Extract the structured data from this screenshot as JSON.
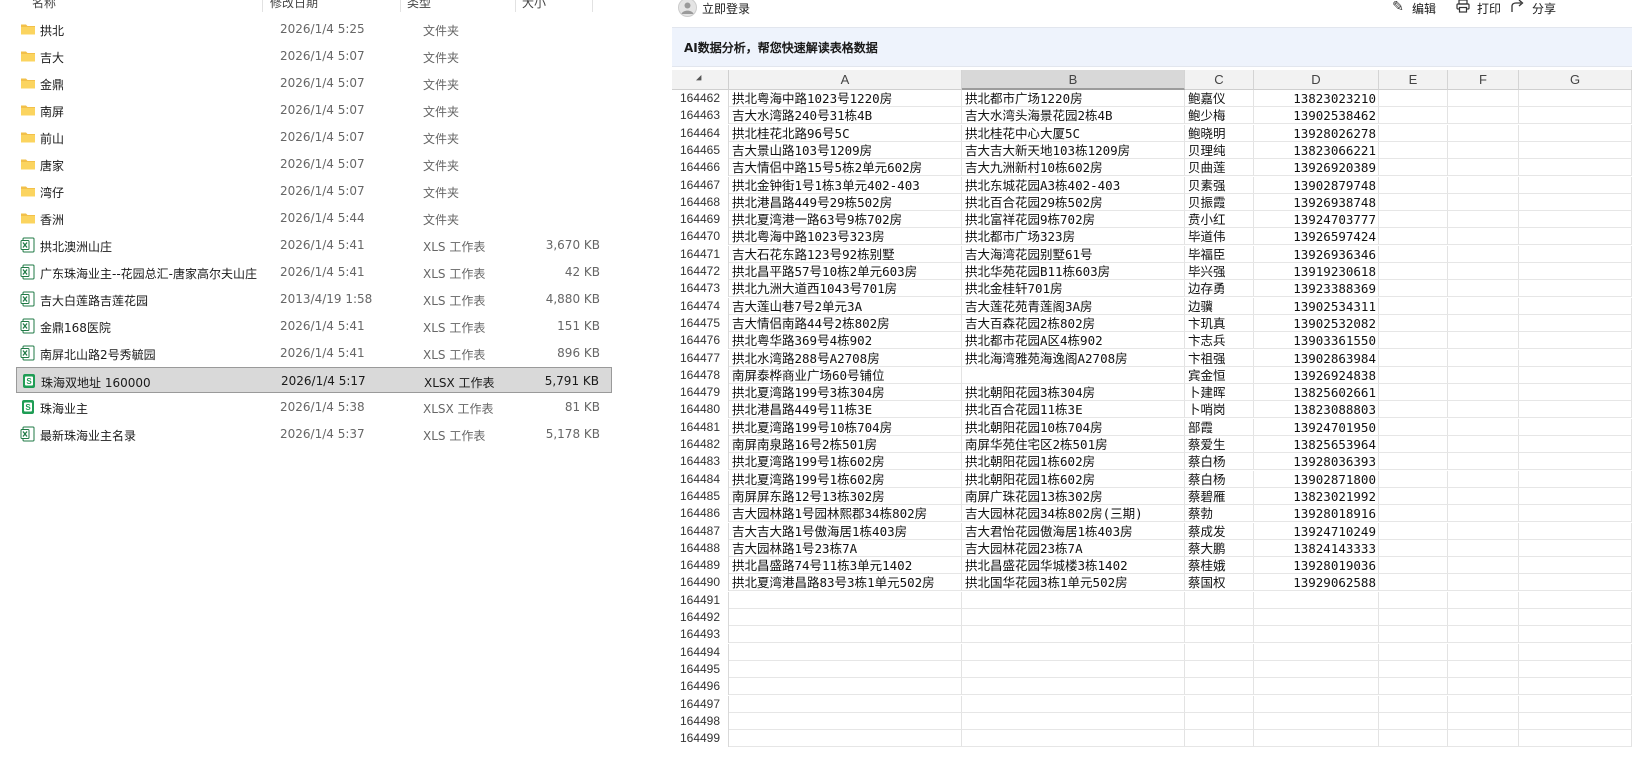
{
  "explorer": {
    "headers": {
      "name": "名称",
      "date": "修改日期",
      "type": "类型",
      "size": "大小"
    },
    "files": [
      {
        "name": "拱北",
        "date": "2026/1/4 5:25",
        "type": "文件夹",
        "size": "",
        "kind": "folder"
      },
      {
        "name": "吉大",
        "date": "2026/1/4 5:07",
        "type": "文件夹",
        "size": "",
        "kind": "folder"
      },
      {
        "name": "金鼎",
        "date": "2026/1/4 5:07",
        "type": "文件夹",
        "size": "",
        "kind": "folder"
      },
      {
        "name": "南屏",
        "date": "2026/1/4 5:07",
        "type": "文件夹",
        "size": "",
        "kind": "folder"
      },
      {
        "name": "前山",
        "date": "2026/1/4 5:07",
        "type": "文件夹",
        "size": "",
        "kind": "folder"
      },
      {
        "name": "唐家",
        "date": "2026/1/4 5:07",
        "type": "文件夹",
        "size": "",
        "kind": "folder"
      },
      {
        "name": "湾仔",
        "date": "2026/1/4 5:07",
        "type": "文件夹",
        "size": "",
        "kind": "folder"
      },
      {
        "name": "香洲",
        "date": "2026/1/4 5:44",
        "type": "文件夹",
        "size": "",
        "kind": "folder"
      },
      {
        "name": "拱北澳洲山庄",
        "date": "2026/1/4 5:41",
        "type": "XLS 工作表",
        "size": "3,670 KB",
        "kind": "xls"
      },
      {
        "name": "广东珠海业主--花园总汇-唐家高尔夫山庄",
        "date": "2026/1/4 5:41",
        "type": "XLS 工作表",
        "size": "42 KB",
        "kind": "xls"
      },
      {
        "name": "吉大白莲路吉莲花园",
        "date": "2013/4/19 1:58",
        "type": "XLS 工作表",
        "size": "4,880 KB",
        "kind": "xls"
      },
      {
        "name": "金鼎168医院",
        "date": "2026/1/4 5:41",
        "type": "XLS 工作表",
        "size": "151 KB",
        "kind": "xls"
      },
      {
        "name": "南屏北山路2号秀毓园",
        "date": "2026/1/4 5:41",
        "type": "XLS 工作表",
        "size": "896 KB",
        "kind": "xls"
      },
      {
        "name": "珠海双地址 160000",
        "date": "2026/1/4 5:17",
        "type": "XLSX 工作表",
        "size": "5,791 KB",
        "kind": "xlsx",
        "selected": true
      },
      {
        "name": "珠海业主",
        "date": "2026/1/4 5:38",
        "type": "XLSX 工作表",
        "size": "81 KB",
        "kind": "xlsx"
      },
      {
        "name": "最新珠海业主名录",
        "date": "2026/1/4 5:37",
        "type": "XLS 工作表",
        "size": "5,178 KB",
        "kind": "xls"
      }
    ]
  },
  "viewer": {
    "login_label": "立即登录",
    "edit_label": "编辑",
    "print_label": "打印",
    "share_label": "分享",
    "ai_banner": "AI数据分析，帮您快速解读表格数据",
    "columns": [
      "A",
      "B",
      "C",
      "D",
      "E",
      "F",
      "G"
    ],
    "active_column": "B",
    "rows": [
      {
        "n": "164462",
        "a": "拱北粤海中路1023号1220房",
        "b": "拱北都市广场1220房",
        "c": "鲍嘉仪",
        "d": "13823023210"
      },
      {
        "n": "164463",
        "a": "吉大水湾路240号31栋4B",
        "b": "吉大水湾头海景花园2栋4B",
        "c": "鲍少梅",
        "d": "13902538462"
      },
      {
        "n": "164464",
        "a": "拱北桂花北路96号5C",
        "b": "拱北桂花中心大厦5C",
        "c": "鲍晓明",
        "d": "13928026278"
      },
      {
        "n": "164465",
        "a": "吉大景山路103号1209房",
        "b": "吉大吉大新天地103栋1209房",
        "c": "贝理纯",
        "d": "13823066221"
      },
      {
        "n": "164466",
        "a": "吉大情侣中路15号5栋2单元602房",
        "b": "吉大九洲新村10栋602房",
        "c": "贝曲莲",
        "d": "13926920389"
      },
      {
        "n": "164467",
        "a": "拱北金钟街1号1栋3单元402-403",
        "b": "拱北东城花园A3栋402-403",
        "c": "贝素强",
        "d": "13902879748"
      },
      {
        "n": "164468",
        "a": "拱北港昌路449号29栋502房",
        "b": "拱北百合花园29栋502房",
        "c": "贝振霞",
        "d": "13926938748"
      },
      {
        "n": "164469",
        "a": "拱北夏湾港一路63号9栋702房",
        "b": "拱北富祥花园9栋702房",
        "c": "贲小红",
        "d": "13924703777"
      },
      {
        "n": "164470",
        "a": "拱北粤海中路1023号323房",
        "b": "拱北都市广场323房",
        "c": "毕道伟",
        "d": "13926597424"
      },
      {
        "n": "164471",
        "a": "吉大石花东路123号92栋别墅",
        "b": "吉大海湾花园别墅61号",
        "c": "毕福臣",
        "d": "13926936346"
      },
      {
        "n": "164472",
        "a": "拱北昌平路57号10栋2单元603房",
        "b": "拱北华苑花园B11栋603房",
        "c": "毕兴强",
        "d": "13919230618"
      },
      {
        "n": "164473",
        "a": "拱北九洲大道西1043号701房",
        "b": "拱北金桂轩701房",
        "c": "边存勇",
        "d": "13923388369"
      },
      {
        "n": "164474",
        "a": "吉大莲山巷7号2单元3A",
        "b": "吉大莲花苑青莲阁3A房",
        "c": "边骥",
        "d": "13902534311"
      },
      {
        "n": "164475",
        "a": "吉大情侣南路44号2栋802房",
        "b": "吉大百森花园2栋802房",
        "c": "卞玑真",
        "d": "13902532082"
      },
      {
        "n": "164476",
        "a": "拱北粤华路369号4栋902",
        "b": "拱北都市花园A区4栋902",
        "c": "卞志兵",
        "d": "13903361550"
      },
      {
        "n": "164477",
        "a": "拱北水湾路288号A2708房",
        "b": "拱北海湾雅苑海逸阁A2708房",
        "c": "卞祖强",
        "d": "13902863984"
      },
      {
        "n": "164478",
        "a": "南屏泰桦商业广场60号铺位",
        "b": "",
        "c": "宾金恒",
        "d": "13926924838"
      },
      {
        "n": "164479",
        "a": "拱北夏湾路199号3栋304房",
        "b": "拱北朝阳花园3栋304房",
        "c": "卜建晖",
        "d": "13825602661"
      },
      {
        "n": "164480",
        "a": "拱北港昌路449号11栋3E",
        "b": "拱北百合花园11栋3E",
        "c": "卜哨岗",
        "d": "13823088803"
      },
      {
        "n": "164481",
        "a": "拱北夏湾路199号10栋704房",
        "b": "拱北朝阳花园10栋704房",
        "c": "部霞",
        "d": "13924701950"
      },
      {
        "n": "164482",
        "a": "南屏南泉路16号2栋501房",
        "b": "南屏华苑住宅区2栋501房",
        "c": "蔡爱生",
        "d": "13825653964"
      },
      {
        "n": "164483",
        "a": "拱北夏湾路199号1栋602房",
        "b": "拱北朝阳花园1栋602房",
        "c": "蔡白杨",
        "d": "13928036393"
      },
      {
        "n": "164484",
        "a": "拱北夏湾路199号1栋602房",
        "b": "拱北朝阳花园1栋602房",
        "c": "蔡白杨",
        "d": "13902871800"
      },
      {
        "n": "164485",
        "a": "南屏屏东路12号13栋302房",
        "b": "南屏广珠花园13栋302房",
        "c": "蔡碧雁",
        "d": "13823021992"
      },
      {
        "n": "164486",
        "a": "吉大园林路1号园林熙郡34栋802房",
        "b": "吉大园林花园34栋802房(三期)",
        "c": "蔡勃",
        "d": "13928018916"
      },
      {
        "n": "164487",
        "a": "吉大吉大路1号傲海居1栋403房",
        "b": "吉大君怡花园傲海居1栋403房",
        "c": "蔡成发",
        "d": "13924710249"
      },
      {
        "n": "164488",
        "a": "吉大园林路1号23栋7A",
        "b": "吉大园林花园23栋7A",
        "c": "蔡大鹏",
        "d": "13824143333"
      },
      {
        "n": "164489",
        "a": "拱北昌盛路74号11栋3单元1402",
        "b": "拱北昌盛花园华城楼3栋1402",
        "c": "蔡桂娥",
        "d": "13928019036"
      },
      {
        "n": "164490",
        "a": "拱北夏湾港昌路83号3栋1单元502房",
        "b": "拱北国华花园3栋1单元502房",
        "c": "蔡国权",
        "d": "13929062588"
      },
      {
        "n": "164491",
        "a": "",
        "b": "",
        "c": "",
        "d": ""
      },
      {
        "n": "164492",
        "a": "",
        "b": "",
        "c": "",
        "d": ""
      },
      {
        "n": "164493",
        "a": "",
        "b": "",
        "c": "",
        "d": ""
      },
      {
        "n": "164494",
        "a": "",
        "b": "",
        "c": "",
        "d": ""
      },
      {
        "n": "164495",
        "a": "",
        "b": "",
        "c": "",
        "d": ""
      },
      {
        "n": "164496",
        "a": "",
        "b": "",
        "c": "",
        "d": ""
      },
      {
        "n": "164497",
        "a": "",
        "b": "",
        "c": "",
        "d": ""
      },
      {
        "n": "164498",
        "a": "",
        "b": "",
        "c": "",
        "d": ""
      },
      {
        "n": "164499",
        "a": "",
        "b": "",
        "c": "",
        "d": ""
      }
    ]
  }
}
